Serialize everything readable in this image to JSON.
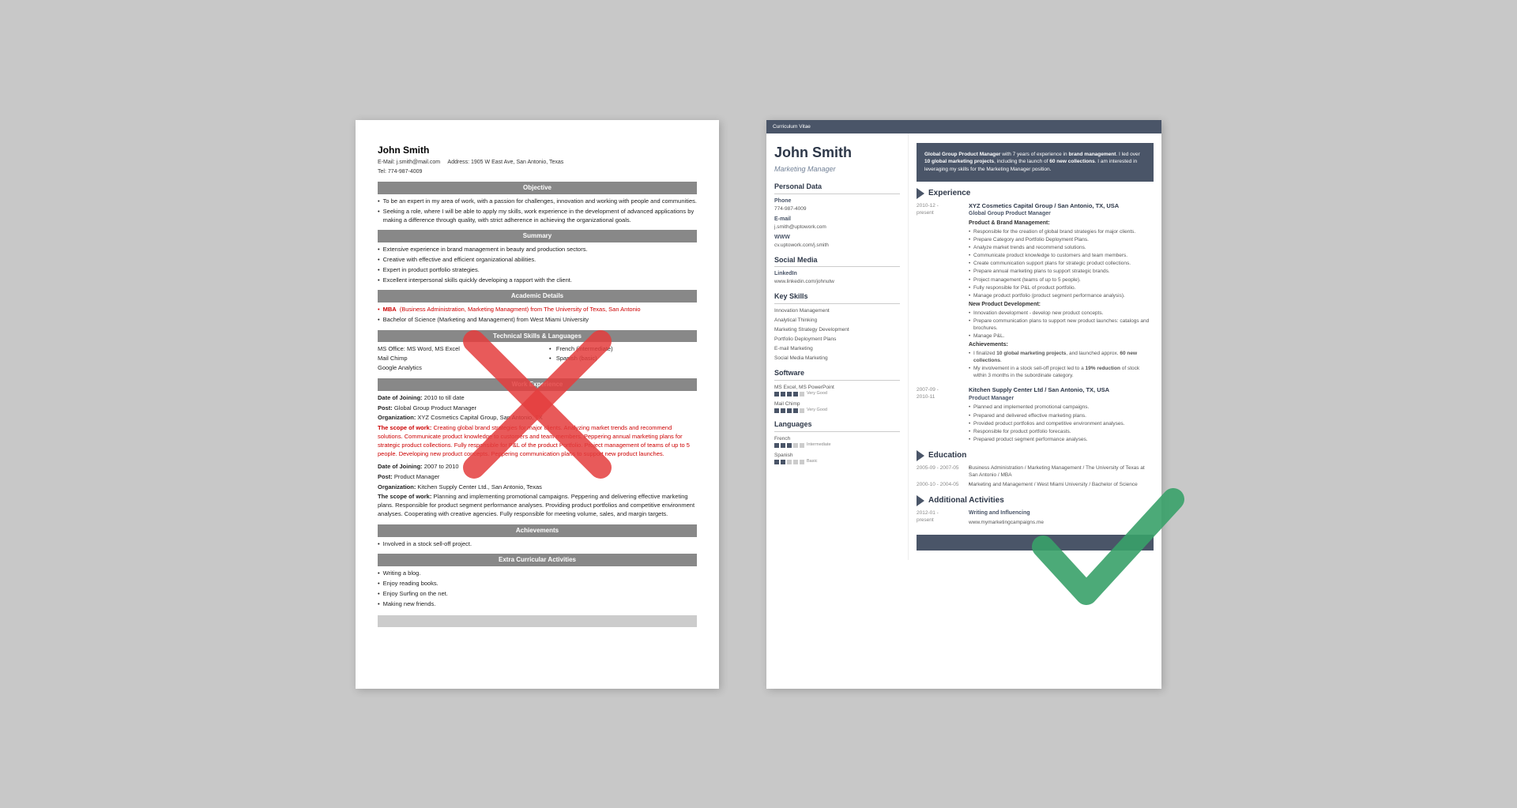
{
  "bad_resume": {
    "name": "John Smith",
    "email_label": "E-Mail:",
    "email": "j.smith@mail.com",
    "address_label": "Address:",
    "address": "1905 W East Ave, San Antonio, Texas",
    "tel_label": "Tel:",
    "tel": "774-987-4009",
    "sections": {
      "objective": {
        "title": "Objective",
        "bullets": [
          "To be an expert in my area of work, with a passion for challenges, innovation and working with people and communities.",
          "Seeking a role, where I will be able to apply my skills, work experience in the development of advanced applications by making a difference through quality, with strict adherence in achieving the organizational goals."
        ]
      },
      "summary": {
        "title": "Summary",
        "bullets": [
          "Extensive experience in brand management in beauty and production sectors.",
          "Creative with effective and efficient organizational abilities.",
          "Expert in product portfolio strategies.",
          "Excellent interpersonal skills quickly developing a rapport with the client."
        ]
      },
      "academic": {
        "title": "Academic Details",
        "bullets": [
          "MBA (Business Administration, Marketing Managment) from The University of Texas, San Antonio",
          "Bachelor of Science (Marketing and Management) from West Miami University"
        ]
      },
      "technical": {
        "title": "Technical Skills & Languages",
        "skills_left": [
          "MS Office: MS Word, MS Excel",
          "Mail Chimp",
          "Google Analytics"
        ],
        "skills_right": [
          "French (intermediate)",
          "Spanish (basic)"
        ]
      },
      "work_exp": {
        "title": "Work Experience",
        "jobs": [
          {
            "joining": "Date of Joining: 2010 to till date",
            "post": "Post: Global Group Product Manager",
            "org": "Organization: XYZ Cosmetics Capital Group, San Antonio, TX",
            "scope_label": "The scope of work:",
            "scope": "Creating global brand strategies for major clients. Analyzing market trends and recommend solutions. Communicate product knowledge to customers and team members. Peppering annual marketing plans for strategic product collections. Fully responsible for P&L of the product Portfolio. Project management of teams of up to 5 people. Developing new product concepts. Peppering communication plans to support new product launches."
          },
          {
            "joining": "Date of Joining: 2007 to 2010",
            "post": "Post: Product Manager",
            "org": "Organization: Kitchen Supply Center Ltd., San Antonio, Texas",
            "scope_label": "The scope of work:",
            "scope": "Planning and implementing promotional campaigns. Peppering and delivering effective marketing plans. Responsible for product segment performance analyses. Providing product portfolios and competitive environment analyses. Cooperating with creative agencies. Fully responsible for meeting volume, sales, and margin targets."
          }
        ]
      },
      "achievements": {
        "title": "Achievements",
        "items": [
          "Involved in a stock sell-off project."
        ]
      },
      "extra": {
        "title": "Extra Curricular Activities",
        "items": [
          "Writing a blog.",
          "Enjoy reading books.",
          "Enjoy Surfing on the net.",
          "Making new friends."
        ]
      }
    }
  },
  "good_resume": {
    "cv_label": "Curriculum Vitae",
    "name": "John Smith",
    "title": "Marketing Manager",
    "intro": "Global Group Product Manager with 7 years of experience in brand management. I led over 10 global marketing projects, including the launch of 60 new collections. I am interested in leveraging my skills for the Marketing Manager position.",
    "personal_data": {
      "section_title": "Personal Data",
      "phone_label": "Phone",
      "phone": "774-987-4009",
      "email_label": "E-mail",
      "email": "j.smith@uptowork.com",
      "www_label": "WWW",
      "www": "cv.uptowork.com/j.smith"
    },
    "social_media": {
      "section_title": "Social Media",
      "linkedin_label": "LinkedIn",
      "linkedin": "www.linkedin.com/johnutw"
    },
    "key_skills": {
      "section_title": "Key Skills",
      "items": [
        "Innovation Management",
        "Analytical Thinking",
        "Marketing Strategy Development",
        "Portfolio Deployment Plans",
        "E-mail Marketing",
        "Social Media Marketing"
      ]
    },
    "software": {
      "section_title": "Software",
      "items": [
        {
          "name": "MS Excel, MS PowerPoint",
          "level": 4,
          "max": 5,
          "label": "Very Good"
        },
        {
          "name": "Mail Chimp",
          "level": 4,
          "max": 5,
          "label": "Very Good"
        }
      ]
    },
    "languages": {
      "section_title": "Languages",
      "items": [
        {
          "name": "French",
          "level": 3,
          "max": 5,
          "label": "Intermediate"
        },
        {
          "name": "Spanish",
          "level": 2,
          "max": 5,
          "label": "Basic"
        }
      ]
    },
    "experience": {
      "section_title": "Experience",
      "jobs": [
        {
          "date_start": "2010-12 -",
          "date_end": "present",
          "company": "XYZ Cosmetics Capital Group / San Antonio, TX, USA",
          "role": "Global Group Product Manager",
          "subsections": [
            {
              "header": "Product & Brand Management:",
              "bullets": [
                "Responsible for the creation of global brand strategies for major clients.",
                "Prepare Category and Portfolio Deployment Plans.",
                "Analyze market trends and recommend solutions.",
                "Communicate product knowledge to customers and team members.",
                "Create communication support plans for strategic product collections.",
                "Prepare annual marketing plans to support strategic brands.",
                "Project management (teams of up to 5 people).",
                "Fully responsible for P&L of product portfolio.",
                "Manage product portfolio (product segment performance analysis)."
              ]
            },
            {
              "header": "New Product Development:",
              "bullets": [
                "Innovation development - develop new product concepts.",
                "Prepare communication plans to support new product launches: catalogs and brochures.",
                "Manage P&L."
              ]
            },
            {
              "header": "Achievements:",
              "bullets": [
                "I finalized 10 global marketing projects, and launched approx. 60 new collections.",
                "My involvement in a stock sell-off project led to a 19% reduction of stock within 3 months in the subordinate category."
              ]
            }
          ]
        },
        {
          "date_start": "2007-09 -",
          "date_end": "2010-11",
          "company": "Kitchen Supply Center Ltd / San Antonio, TX, USA",
          "role": "Product Manager",
          "subsections": [
            {
              "header": "",
              "bullets": [
                "Planned and implemented promotional campaigns.",
                "Prepared and delivered effective marketing plans.",
                "Provided product portfolios and competitive environment analyses.",
                "Responsible for product portfolio forecasts.",
                "Prepared product segment performance analyses."
              ]
            }
          ]
        }
      ]
    },
    "education": {
      "section_title": "Education",
      "items": [
        {
          "date": "2005-09 - 2007-05",
          "degree": "Business Administration / Marketing Management / The University of Texas at San Antonio / MBA"
        },
        {
          "date": "2000-10 - 2004-05",
          "degree": "Marketing and Management / West Miami University / Bachelor of Science"
        }
      ]
    },
    "additional": {
      "section_title": "Additional Activities",
      "items": [
        {
          "date": "2012-01 - present",
          "title": "Writing and Influencing",
          "url": "www.mymarketingcampaigns.me"
        }
      ]
    }
  }
}
